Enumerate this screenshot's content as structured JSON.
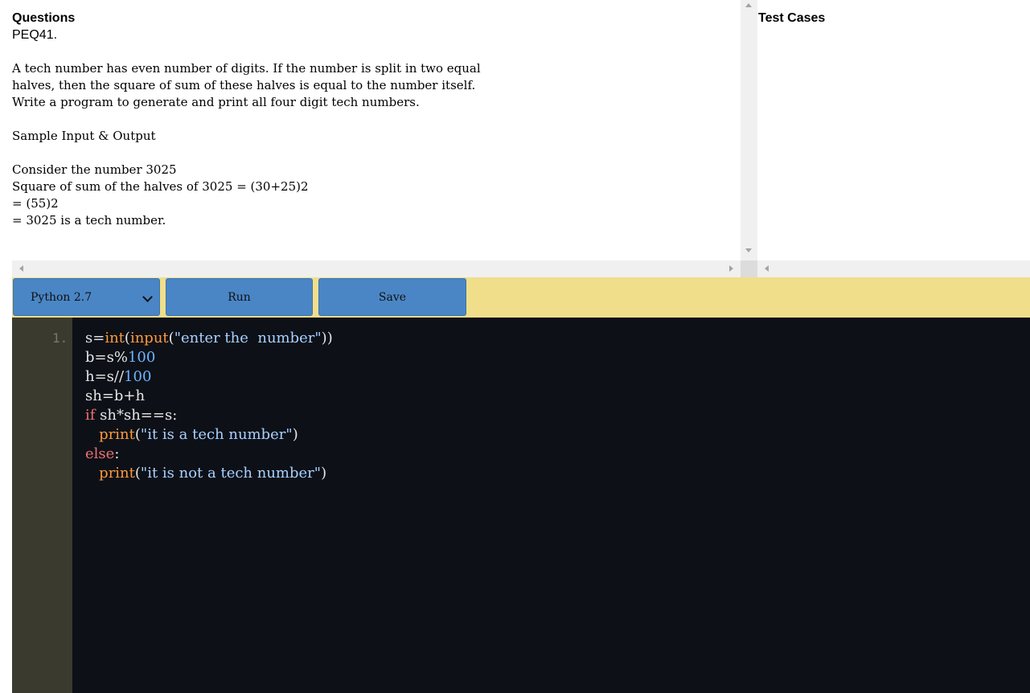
{
  "question_panel": {
    "heading": "Questions",
    "code": "PEQ41.",
    "paragraph_lines": [
      "A tech number has even number of digits. If the number is split in two equal",
      "halves, then the square of sum of these halves is equal to the number itself.",
      "Write a program to generate and print all four digit tech numbers."
    ],
    "sample_heading": "Sample Input & Output",
    "example_lines": [
      "Consider the number 3025",
      "Square of sum of the halves of 3025 = (30+25)2",
      "= (55)2",
      "= 3025 is a tech number."
    ]
  },
  "test_cases": {
    "title": "Test Cases"
  },
  "toolbar": {
    "language_selected": "Python 2.7",
    "run_label": "Run",
    "save_label": "Save"
  },
  "editor": {
    "line_number": "1.",
    "lines": [
      "s=int(input(\"enter the  number\"))",
      "b=s%100",
      "h=s//100",
      "sh=b+h",
      "if sh*sh==s:",
      "   print(\"it is a tech number\")",
      "else:",
      "   print(\"it is not a tech number\")"
    ]
  },
  "colors": {
    "toolbar_bg": "#f0de8a",
    "button_bg": "#4a86c5",
    "editor_bg": "#0d1017",
    "gutter_bg": "#3a3a2e",
    "keyword": "#f07070",
    "function": "#ff9a3c",
    "string": "#a8d1ff",
    "number": "#6cb4ff"
  }
}
